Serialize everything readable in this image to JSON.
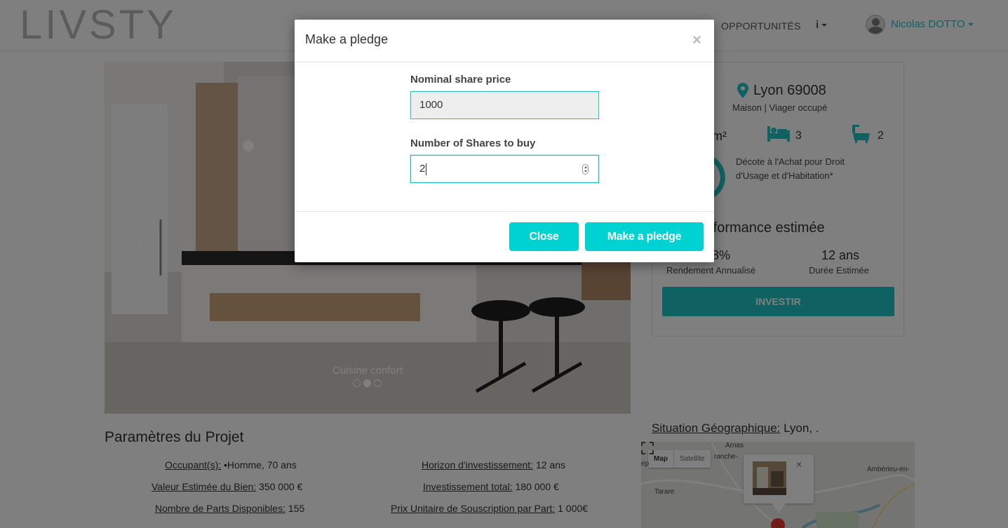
{
  "navbar": {
    "logo": "LIVSTY",
    "opportunites": "OPPORTUNITÉS",
    "info_icon": "i",
    "user_name": "Nicolas DOTTO",
    "avatar_icon": "user-avatar-icon"
  },
  "carousel": {
    "caption": "Cuisine confort",
    "prev_icon": "‹",
    "slide_count": 3,
    "active_slide": 2
  },
  "property": {
    "location": "Lyon 69008",
    "subtitle": "Maison | Viager occupé",
    "surface_fragment": "m²",
    "bedrooms": "3",
    "bathrooms": "2",
    "decote": "Décote à l'Achat pour Droit d'Usage et d'Habitation*",
    "perf_title_fragment": "rformance estimée",
    "rendement_value_fragment": "8%",
    "rendement_label": "Rendement Annualisé",
    "duree_value": "12 ans",
    "duree_label": "Durée Estimée",
    "invest_button": "INVESTIR"
  },
  "params": {
    "title": "Paramètres du Projet",
    "occupant_key": "Occupant(s):",
    "occupant_val": " •Homme, 70 ans",
    "valeur_key": "Valeur Estimée du Bien:",
    "valeur_val": " 350 000 €",
    "parts_key": "Nombre de Parts Disponibles:",
    "parts_val": " 155",
    "horizon_key": "Horizon d'investissement:",
    "horizon_val": " 12 ans",
    "total_key": "Investissement total:",
    "total_val": " 180 000 €",
    "prix_key": "Prix Unitaire de Souscription par Part:",
    "prix_val": " 1 000€"
  },
  "map": {
    "situ_key": "Situation Géographique:",
    "situ_val": " Lyon, .",
    "type_map": "Map",
    "type_satellite": "Satellite",
    "label_arnas": "Arnas",
    "label_franche": "ranche-",
    "label_ep": "ep",
    "label_tarare": "Tarare",
    "label_amberieu": "Ambérieu-en-",
    "popup_close": "×"
  },
  "modal": {
    "title": "Make a pledge",
    "close_icon": "×",
    "nominal_label": "Nominal share price",
    "nominal_value": "1000",
    "shares_label": "Number of Shares to buy",
    "shares_value": "2",
    "close_button": "Close",
    "pledge_button": "Make a pledge"
  },
  "colors": {
    "accent": "#1fc2c4",
    "button": "#00d1d1",
    "backdrop": "rgba(0,0,0,0.5)"
  }
}
